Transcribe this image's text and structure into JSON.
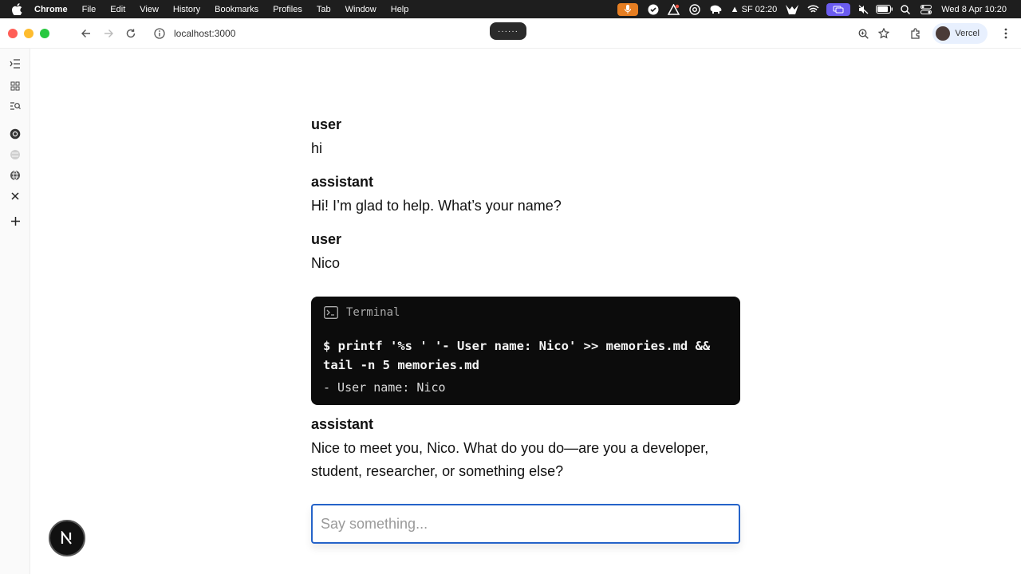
{
  "menubar": {
    "app_name": "Chrome",
    "menus": [
      "File",
      "Edit",
      "View",
      "History",
      "Bookmarks",
      "Profiles",
      "Tab",
      "Window",
      "Help"
    ],
    "weather": "SF 02:20",
    "datetime": "Wed 8 Apr  10:20"
  },
  "browser": {
    "url": "localhost:3000",
    "pill_text": "······",
    "profile_name": "Vercel"
  },
  "chat": {
    "messages": [
      {
        "role": "user",
        "text": "hi"
      },
      {
        "role": "assistant",
        "text": "Hi! I’m glad to help. What’s your name?"
      },
      {
        "role": "user",
        "text": "Nico"
      },
      {
        "role": "assistant",
        "text": "Nice to meet you, Nico. What do you do—are you a developer, student, researcher, or something else?"
      }
    ],
    "terminal": {
      "title": "Terminal",
      "command": "$ printf '%s ' '- User name: Nico' >> memories.md && tail -n 5 memories.md",
      "output": "- User name: Nico"
    },
    "input": {
      "placeholder": "Say something...",
      "value": ""
    }
  },
  "icons": {
    "next_badge": "N"
  },
  "colors": {
    "input_border": "#2563c9",
    "terminal_bg": "#0c0c0c",
    "mic_accent": "#e67e22",
    "screens_accent": "#6b5cf0"
  }
}
